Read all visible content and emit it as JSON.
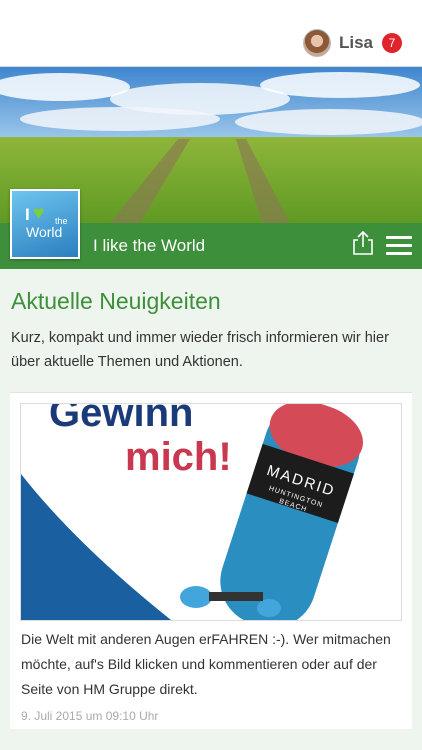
{
  "user": {
    "name": "Lisa",
    "notifications": "7"
  },
  "site": {
    "title": "I like the World",
    "logo": {
      "i": "I",
      "the": "the",
      "world": "World"
    }
  },
  "news": {
    "heading": "Aktuelle Neuigkeiten",
    "intro": "Kurz, kompakt und immer wieder frisch informieren wir hier über aktuelle Themen und Aktionen."
  },
  "post": {
    "image_text_top": "Gewinn",
    "image_text_bottom": "mich!",
    "board_title": "MADRID",
    "board_sub1": "HUNTINGTON",
    "board_sub2": "BEACH",
    "text": "Die Welt mit anderen Augen erFAHREN :-). Wer mitmachen möchte, auf's Bild klicken und kommentieren oder auf der Seite von HM Gruppe direkt.",
    "date": "9. Juli 2015 um 09:10 Uhr"
  },
  "icons": {
    "share": "share-icon",
    "menu": "hamburger-menu-icon",
    "heart": "heart-icon"
  },
  "colors": {
    "brand_green": "#3e8f3b",
    "badge_red": "#e0242c",
    "background": "#eef5ee"
  }
}
